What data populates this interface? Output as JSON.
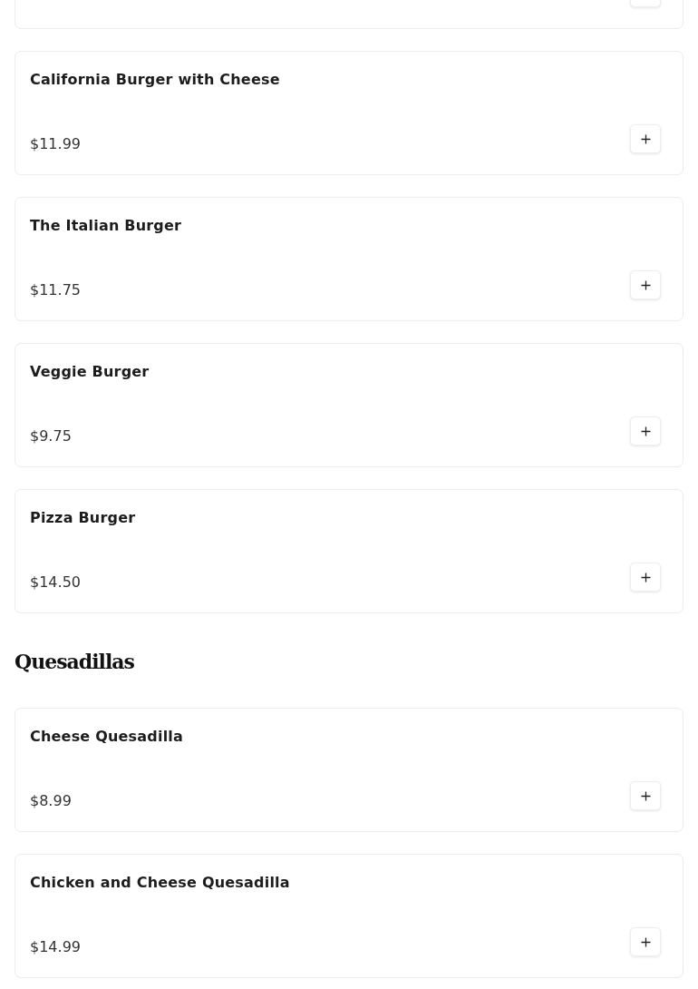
{
  "sections": [
    {
      "items": [
        {
          "kind": "partial"
        },
        {
          "name": "California Burger with Cheese",
          "price": "$11.99"
        },
        {
          "name": "The Italian Burger",
          "price": "$11.75"
        },
        {
          "name": "Veggie Burger",
          "price": "$9.75"
        },
        {
          "name": "Pizza Burger",
          "price": "$14.50"
        }
      ]
    },
    {
      "heading": "Quesadillas",
      "items": [
        {
          "name": "Cheese Quesadilla",
          "price": "$8.99"
        },
        {
          "name": "Chicken and Cheese Quesadilla",
          "price": "$14.99"
        }
      ]
    }
  ]
}
